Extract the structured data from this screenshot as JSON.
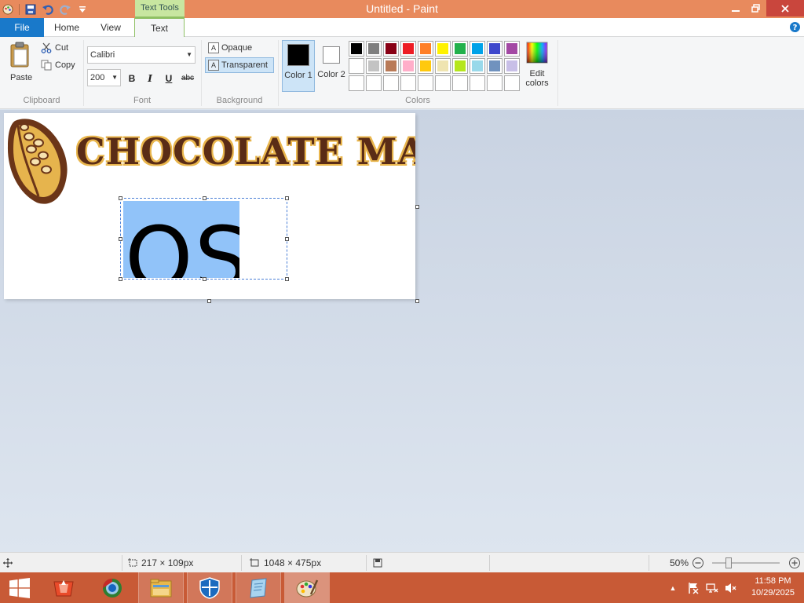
{
  "window": {
    "title": "Untitled - Paint",
    "context_tab_group": "Text Tools"
  },
  "tabs": [
    {
      "label": "File"
    },
    {
      "label": "Home"
    },
    {
      "label": "View"
    },
    {
      "label": "Text",
      "active": true
    }
  ],
  "ribbon": {
    "clipboard": {
      "paste": "Paste",
      "cut": "Cut",
      "copy": "Copy",
      "group_label": "Clipboard"
    },
    "font": {
      "family": "Calibri",
      "size": "200",
      "bold": "B",
      "italic": "I",
      "underline": "U",
      "strikethrough": "abc",
      "group_label": "Font"
    },
    "background": {
      "opaque": "Opaque",
      "transparent": "Transparent",
      "selected": "transparent",
      "group_label": "Background"
    },
    "colors": {
      "color1_label": "Color 1",
      "color1_value": "#000000",
      "color2_label": "Color 2",
      "color2_value": "#ffffff",
      "edit_colors": "Edit colors",
      "group_label": "Colors",
      "palette_row1": [
        "#000000",
        "#7f7f7f",
        "#880015",
        "#ed1c24",
        "#ff7f27",
        "#fff200",
        "#22b14c",
        "#00a2e8",
        "#3f48cc",
        "#a349a4"
      ],
      "palette_row2": [
        "#ffffff",
        "#c3c3c3",
        "#b97a57",
        "#ffaec9",
        "#ffc90e",
        "#efe4b0",
        "#b5e61d",
        "#99d9ea",
        "#7092be",
        "#c8bfe7"
      ]
    }
  },
  "canvas": {
    "logo_text": "CHOCOLATE MAN",
    "typed_text": "OS"
  },
  "status": {
    "selection_size": "217 × 109px",
    "image_size": "1048 × 475px",
    "zoom": "50%"
  },
  "taskbar": {
    "time": "11:58 PM",
    "date": "10/29/2025"
  }
}
